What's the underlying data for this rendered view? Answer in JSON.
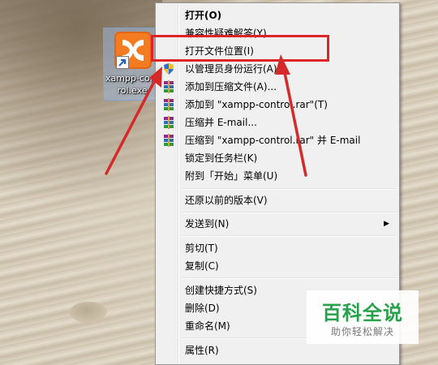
{
  "desktop": {
    "icon_label": "xampp-control.exe",
    "icon_name": "xampp-logo-icon"
  },
  "context_menu": {
    "items": [
      {
        "label": "打开(O)",
        "bold": true,
        "icon": ""
      },
      {
        "label": "兼容性疑难解答(Y)",
        "icon": ""
      },
      {
        "label": "打开文件位置(I)",
        "icon": ""
      },
      {
        "label": "以管理员身份运行(A)",
        "icon": "shield-icon"
      },
      {
        "label": "添加到压缩文件(A)...",
        "icon": "winrar-icon"
      },
      {
        "label": "添加到 \"xampp-control.rar\"(T)",
        "icon": "winrar-icon"
      },
      {
        "label": "压缩并 E-mail...",
        "icon": "winrar-icon"
      },
      {
        "label": "压缩到 \"xampp-control.rar\" 并 E-mail",
        "icon": "winrar-icon"
      },
      {
        "label": "锁定到任务栏(K)",
        "icon": ""
      },
      {
        "label": "附到「开始」菜单(U)",
        "icon": ""
      },
      {
        "label": "还原以前的版本(V)",
        "icon": ""
      },
      {
        "label": "发送到(N)",
        "icon": "",
        "submenu": true
      },
      {
        "label": "剪切(T)",
        "icon": ""
      },
      {
        "label": "复制(C)",
        "icon": ""
      },
      {
        "label": "创建快捷方式(S)",
        "icon": ""
      },
      {
        "label": "删除(D)",
        "icon": ""
      },
      {
        "label": "重命名(M)",
        "icon": ""
      },
      {
        "label": "属性(R)",
        "icon": ""
      }
    ],
    "submenu_glyph": "▶"
  },
  "annotation": {
    "highlight_target": "打开文件位置(I)",
    "color": "#e02424"
  },
  "watermark": {
    "title": "百科全说",
    "subtitle": "助你轻松解决",
    "color": "#27a24b"
  }
}
